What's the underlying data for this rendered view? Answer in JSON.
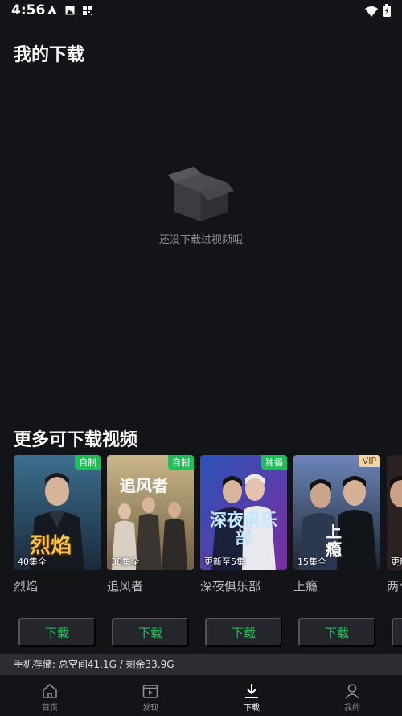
{
  "status_bar": {
    "time": "4:56"
  },
  "header": {
    "title": "我的下载"
  },
  "empty_state": {
    "text": "还没下载过视频哦"
  },
  "recommend": {
    "title": "更多可下载视频",
    "items": [
      {
        "title": "烈焰",
        "badge": "自制",
        "badge_style": "green",
        "episodes": "40集全",
        "poster_text": "烈焰",
        "download_label": "下载"
      },
      {
        "title": "追风者",
        "badge": "自制",
        "badge_style": "green",
        "episodes": "38集全",
        "poster_text": "追风者",
        "download_label": "下载"
      },
      {
        "title": "深夜俱乐部",
        "badge": "独播",
        "badge_style": "green",
        "episodes": "更新至5集",
        "poster_text": "深夜俱乐部",
        "download_label": "下载"
      },
      {
        "title": "上瘾",
        "badge": "VIP",
        "badge_style": "vip",
        "episodes": "15集全",
        "poster_text": "上瘾",
        "download_label": "下载"
      },
      {
        "title": "两个",
        "badge": "",
        "badge_style": "",
        "episodes": "更新",
        "poster_text": "",
        "download_label": "下载"
      }
    ]
  },
  "storage": {
    "text": "手机存储: 总空间41.1G / 剩余33.9G"
  },
  "tabbar": {
    "tabs": [
      {
        "label": "首页",
        "icon": "home-icon"
      },
      {
        "label": "发现",
        "icon": "video-icon"
      },
      {
        "label": "下载",
        "icon": "download-icon"
      },
      {
        "label": "我的",
        "icon": "profile-icon"
      }
    ]
  }
}
